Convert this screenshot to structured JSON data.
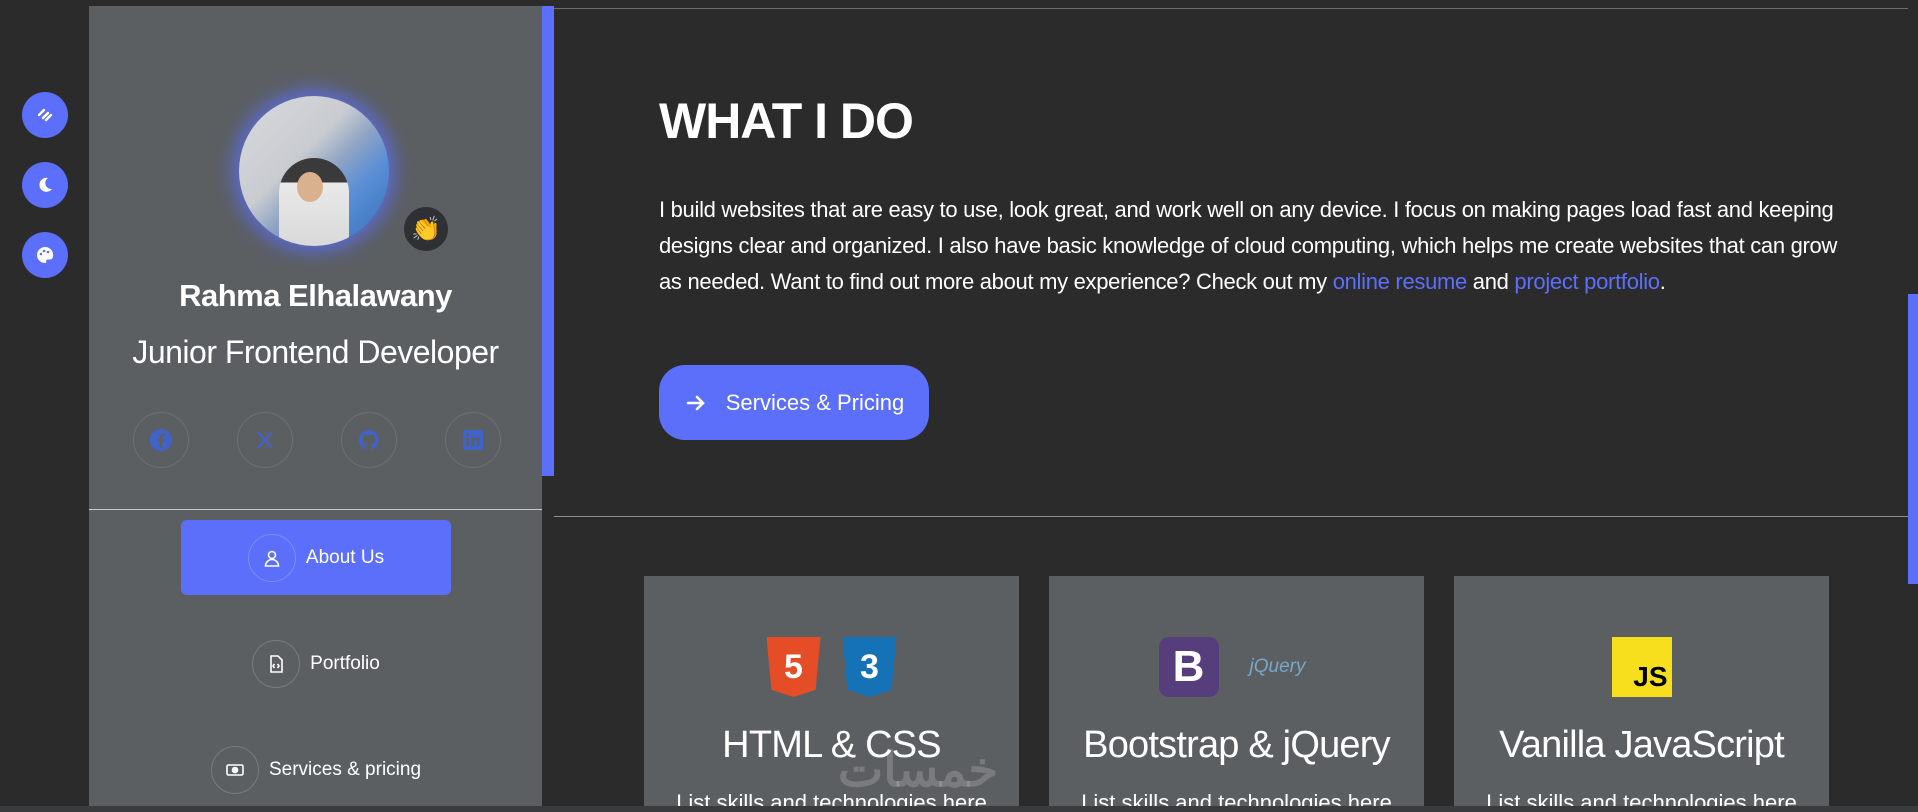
{
  "colors": {
    "accent": "#5b6ffb",
    "sidebar": "#5c5f62",
    "background": "#2b2b2c"
  },
  "rail": {
    "buttons": [
      {
        "name": "settings-toggle",
        "icon": "sliders-icon"
      },
      {
        "name": "dark-mode-toggle",
        "icon": "moon-icon"
      },
      {
        "name": "color-theme-toggle",
        "icon": "palette-icon"
      }
    ]
  },
  "profile": {
    "name": "Rahma Elhalawany",
    "role": "Junior Frontend Developer",
    "badge_emoji": "👏",
    "socials": [
      {
        "name": "facebook",
        "icon": "facebook-icon"
      },
      {
        "name": "x",
        "icon": "x-icon"
      },
      {
        "name": "github",
        "icon": "github-icon"
      },
      {
        "name": "linkedin",
        "icon": "linkedin-icon"
      }
    ]
  },
  "nav": {
    "items": [
      {
        "label": "About Us",
        "icon": "user-icon",
        "active": true
      },
      {
        "label": "Portfolio",
        "icon": "file-code-icon",
        "active": false
      },
      {
        "label": "Services & pricing",
        "icon": "money-icon",
        "active": false
      }
    ]
  },
  "main": {
    "title": "WHAT I DO",
    "intro_text": "I build websites that are easy to use, look great, and work well on any device. I focus on making pages load fast and keeping designs clear and organized. I also have basic knowledge of cloud computing, which helps me create websites that can grow as needed. Want to find out more about my experience? Check out my ",
    "link_resume": "online resume",
    "and_text": " and ",
    "link_portfolio": "project portfolio",
    "period": ".",
    "cta_label": "Services & Pricing",
    "cards": [
      {
        "title": "HTML & CSS",
        "desc": "List skills and technologies here",
        "logos": [
          "5",
          "3"
        ]
      },
      {
        "title": "Bootstrap & jQuery",
        "desc": "List skills and technologies here",
        "logos": [
          "B",
          "jQuery"
        ]
      },
      {
        "title": "Vanilla JavaScript",
        "desc": "List skills and technologies here",
        "logos": [
          "JS"
        ]
      }
    ]
  },
  "watermark": "خمسات"
}
